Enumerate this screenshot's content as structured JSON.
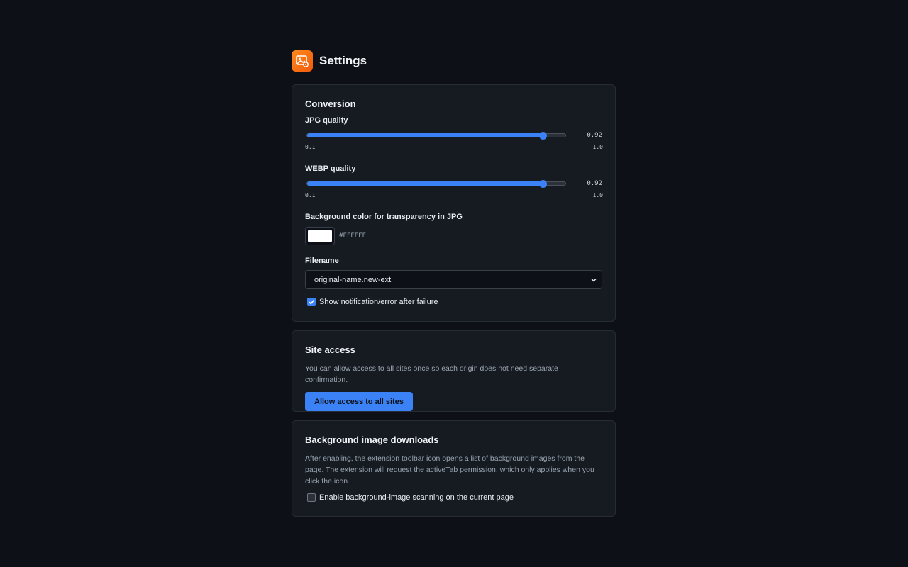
{
  "header": {
    "title": "Settings",
    "icon": "image-gear-icon"
  },
  "conversion": {
    "title": "Conversion",
    "jpg": {
      "label": "JPG quality",
      "value": 0.92,
      "value_text": "0.92",
      "min": 0.1,
      "max": 1.0,
      "min_text": "0.1",
      "max_text": "1.0"
    },
    "webp": {
      "label": "WEBP quality",
      "value": 0.92,
      "value_text": "0.92",
      "min": 0.1,
      "max": 1.0,
      "min_text": "0.1",
      "max_text": "1.0"
    },
    "bg_color": {
      "label": "Background color for transparency in JPG",
      "value": "#FFFFFF"
    },
    "filename": {
      "label": "Filename",
      "selected": "original-name.new-ext"
    },
    "notify": {
      "label": "Show notification/error after failure",
      "checked": true
    }
  },
  "site_access": {
    "title": "Site access",
    "description": "You can allow access to all sites once so each origin does not need separate confirmation.",
    "button_label": "Allow access to all sites"
  },
  "bg_downloads": {
    "title": "Background image downloads",
    "description": "After enabling, the extension toolbar icon opens a list of background images from the page. The extension will request the activeTab permission, which only applies when you click the icon.",
    "checkbox_label": "Enable background-image scanning on the current page",
    "checked": false
  },
  "colors": {
    "background": "#0d1016",
    "card": "#161b22",
    "accent": "#3b82f6",
    "icon_orange": "#f26b0f"
  }
}
